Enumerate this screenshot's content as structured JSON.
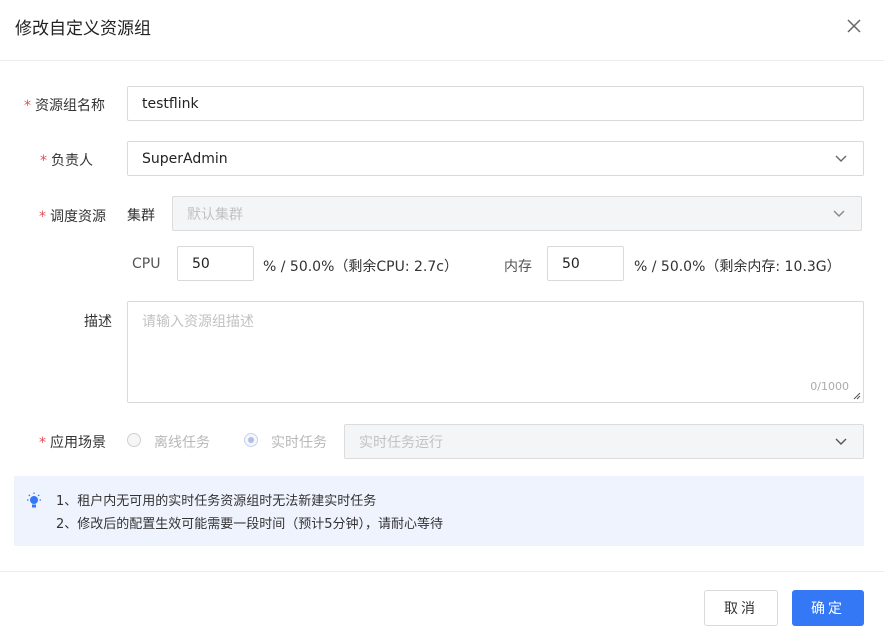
{
  "dialog": {
    "title": "修改自定义资源组"
  },
  "form": {
    "required_mark": "*",
    "name": {
      "label": "资源组名称",
      "value": "testflink"
    },
    "owner": {
      "label": "负责人",
      "value": "SuperAdmin"
    },
    "scheduling": {
      "label": "调度资源",
      "cluster_label": "集群",
      "cluster_placeholder": "默认集群",
      "cpu_label": "CPU",
      "cpu_value": "50",
      "cpu_info": "% / 50.0%（剩余CPU: 2.7c）",
      "mem_label": "内存",
      "mem_value": "50",
      "mem_info": "% / 50.0%（剩余内存: 10.3G）"
    },
    "description": {
      "label": "描述",
      "placeholder": "请输入资源组描述",
      "counter": "0/1000"
    },
    "scenario": {
      "label": "应用场景",
      "options": [
        "离线任务",
        "实时任务"
      ],
      "selected": "实时任务",
      "select_placeholder": "实时任务运行"
    }
  },
  "notice": {
    "icon": "lightbulb-icon",
    "lines": [
      "1、租户内无可用的实时任务资源组时无法新建实时任务",
      "2、修改后的配置生效可能需要一段时间（预计5分钟），请耐心等待"
    ]
  },
  "footer": {
    "cancel_label": "取消",
    "ok_label": "确定"
  },
  "colors": {
    "primary": "#3478f6",
    "required": "#e34d59",
    "notice_bg": "#eef3fd"
  }
}
